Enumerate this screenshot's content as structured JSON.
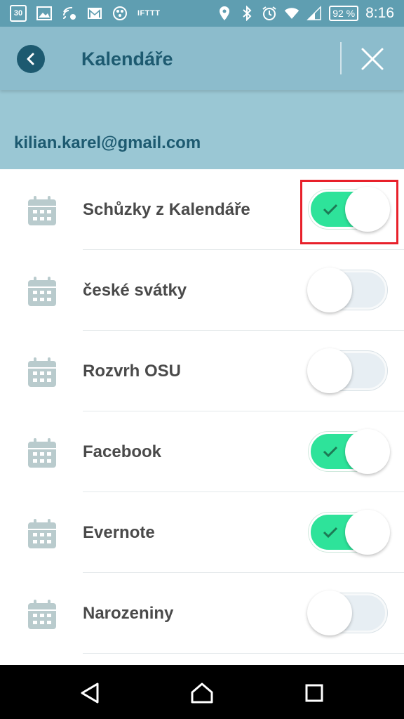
{
  "status_bar": {
    "date_badge": "30",
    "ifttt_label": "IFTTT",
    "battery": "92 %",
    "time": "8:16",
    "icons_left": [
      "calendar-date-icon",
      "image-icon",
      "cast-icon",
      "gmail-icon",
      "app-icon",
      "ifttt-icon"
    ],
    "icons_right": [
      "location-icon",
      "bluetooth-icon",
      "alarm-icon",
      "wifi-icon",
      "signal-icon",
      "battery-icon"
    ]
  },
  "app_bar": {
    "title": "Kalendáře",
    "back_icon": "chevron-left-icon",
    "close_icon": "close-icon"
  },
  "account": {
    "email": "kilian.karel@gmail.com"
  },
  "calendars": [
    {
      "label": "Schůzky z Kalendáře",
      "enabled": true
    },
    {
      "label": "české svátky",
      "enabled": false
    },
    {
      "label": "Rozvrh OSU",
      "enabled": false
    },
    {
      "label": "Facebook",
      "enabled": true
    },
    {
      "label": "Evernote",
      "enabled": true
    },
    {
      "label": "Narozeniny",
      "enabled": false
    }
  ],
  "colors": {
    "app_bar": "#8cbccc",
    "accent": "#1d5a70",
    "toggle_on": "#2ee39a",
    "highlight": "#e8202a"
  },
  "nav_bar": {
    "icons": [
      "back-triangle-icon",
      "home-icon",
      "recents-icon"
    ]
  }
}
